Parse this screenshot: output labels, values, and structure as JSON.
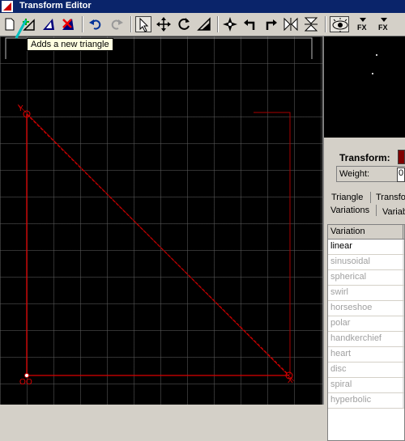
{
  "window": {
    "title": "Transform Editor"
  },
  "tooltip": "Adds a new triangle",
  "panel": {
    "transform_label": "Transform:",
    "weight_label": "Weight:",
    "weight_value": "0",
    "tabs": {
      "row1": [
        "Triangle",
        "Transfo"
      ],
      "row2": [
        "Variations",
        "Variab"
      ]
    }
  },
  "variations": {
    "header": "Variation",
    "items": [
      "linear",
      "sinusoidal",
      "spherical",
      "swirl",
      "horseshoe",
      "polar",
      "handkerchief",
      "heart",
      "disc",
      "spiral",
      "hyperbolic"
    ]
  },
  "triangle": {
    "vertex_labels": [
      "Y",
      "O",
      "X"
    ],
    "color": "#cc0000"
  },
  "toolbar": {
    "icons": [
      "new-document-icon",
      "add-triangle-icon",
      "flip-triangle-icon",
      "delete-triangle-icon",
      "undo-icon",
      "redo-icon",
      "select-pointer-icon",
      "move-icon",
      "rotate-icon",
      "scale-icon",
      "move-center-icon",
      "rotate-left-icon",
      "rotate-right-icon",
      "flip-horizontal-icon",
      "flip-vertical-icon",
      "preview-icon",
      "fx-icon",
      "fx-alt-icon"
    ]
  }
}
